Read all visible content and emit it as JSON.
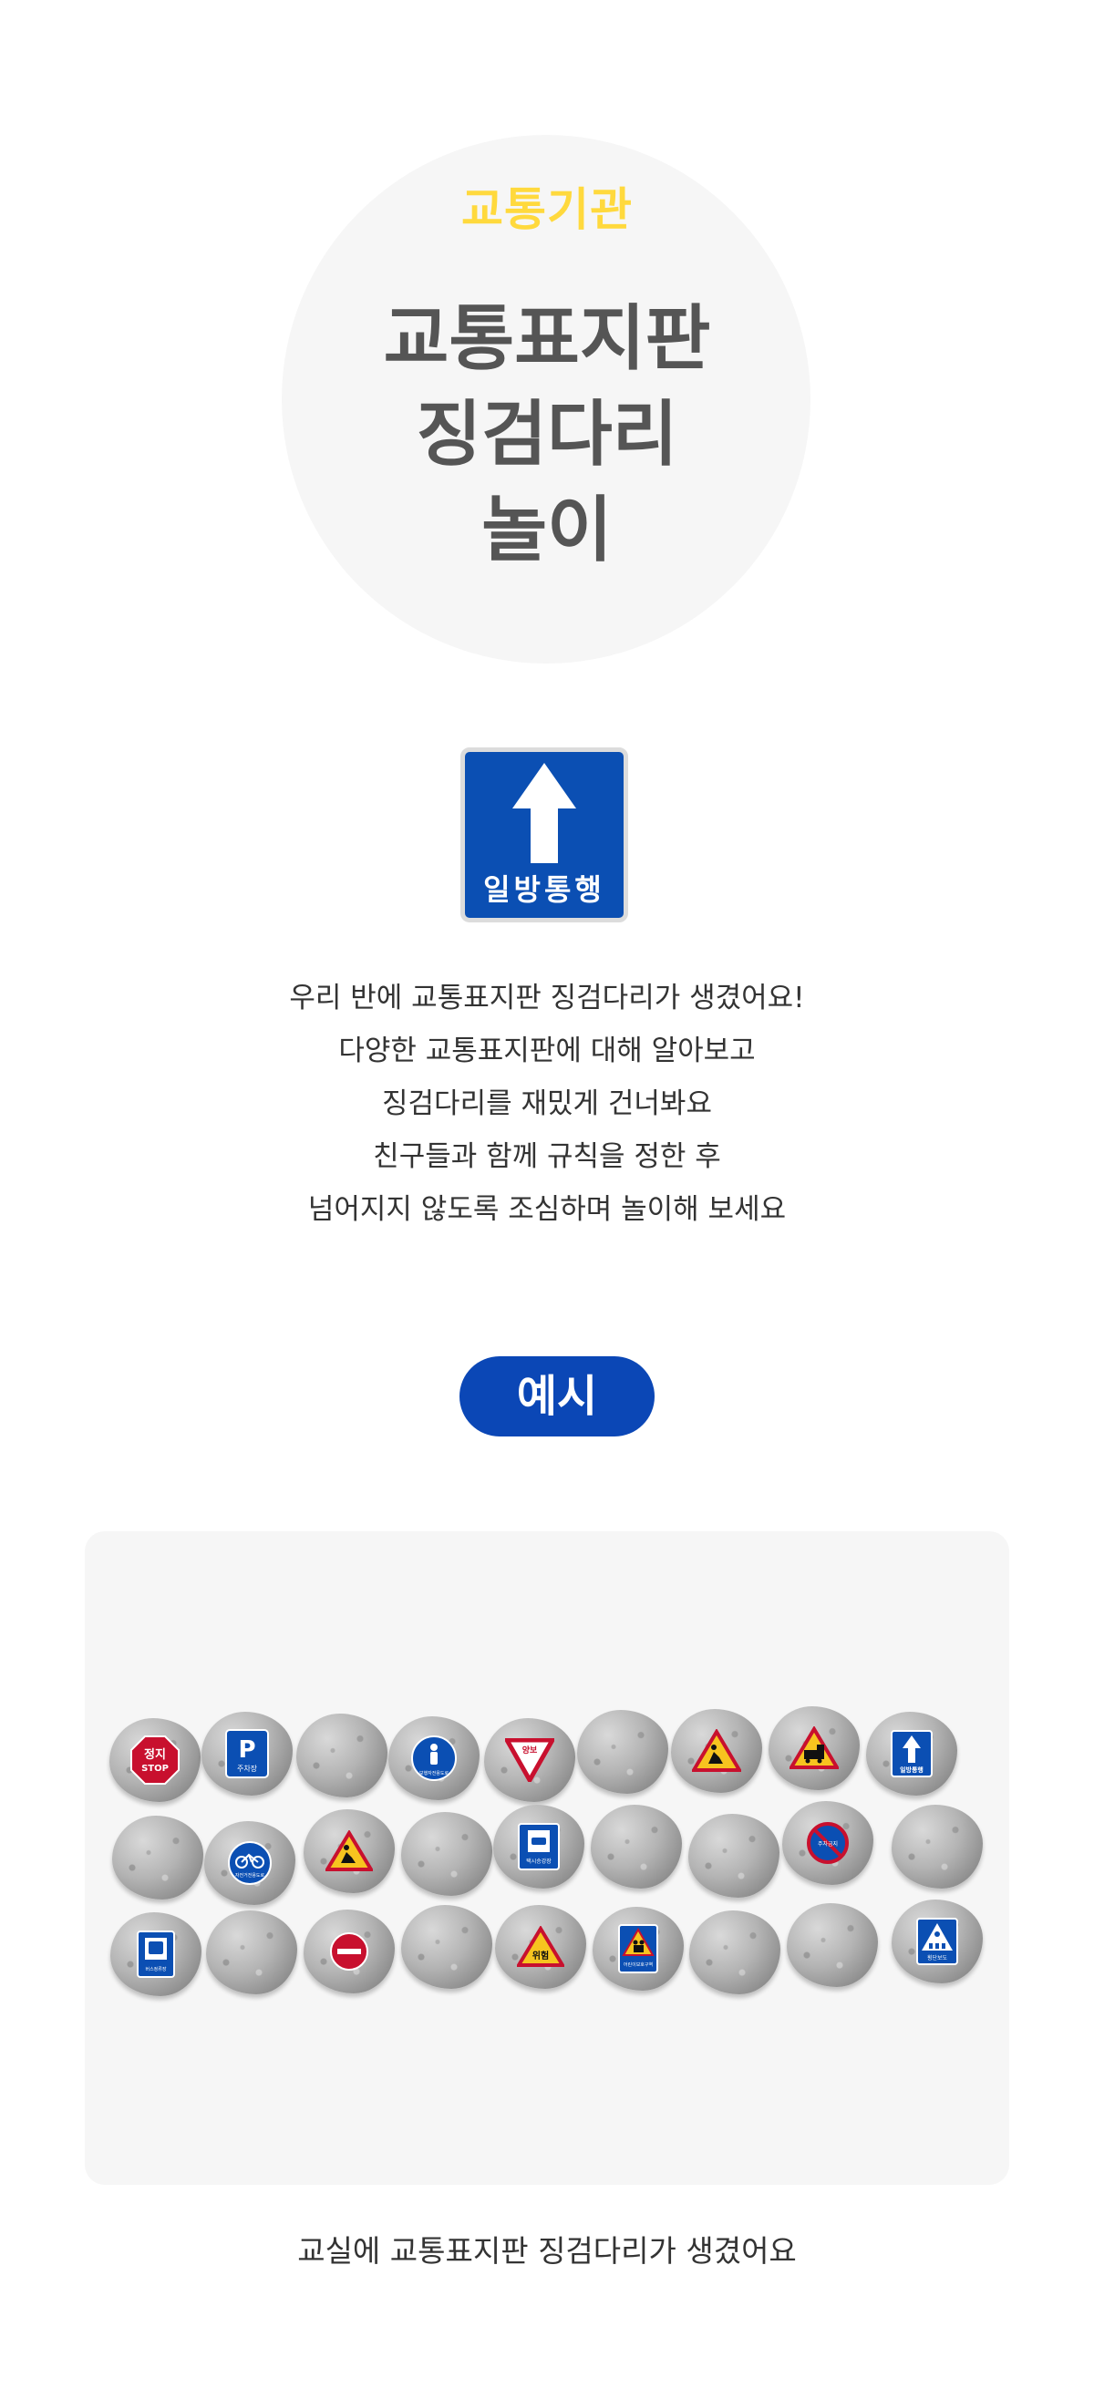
{
  "hero": {
    "eyebrow": "교통기관",
    "title_lines": [
      "교통표지판",
      "징검다리",
      "놀이"
    ]
  },
  "sign_sample": {
    "label": "일방통행",
    "icon": "up-arrow-icon"
  },
  "description": [
    "우리 반에 교통표지판 징검다리가 생겼어요!",
    "다양한 교통표지판에 대해 알아보고",
    "징검다리를 재밌게 건너봐요",
    "친구들과 함께 규칙을 정한 후",
    "넘어지지 않도록 조심하며 놀이해 보세요"
  ],
  "example_label": "예시",
  "stones": {
    "sign_texts": {
      "stop": "정지",
      "stop_en": "STOP",
      "parking_p": "P",
      "parking": "주차장",
      "pedestrian": "보행자전용도로",
      "yield": "양보",
      "oneway": "일방통행",
      "bike": "자전거전용도로",
      "busstop": "버스정류장",
      "taxi": "택시승강장",
      "noparking": "주차금지",
      "danger": "위험",
      "schoolzone": "어린이보호구역",
      "crosswalk": "횡단보도"
    }
  },
  "caption": "교실에 교통표지판 징검다리가 생겼어요",
  "colors": {
    "accent_yellow": "#ffd93d",
    "title_gray": "#555555",
    "brand_blue": "#0b47b6",
    "panel_bg": "#f6f6f6"
  }
}
